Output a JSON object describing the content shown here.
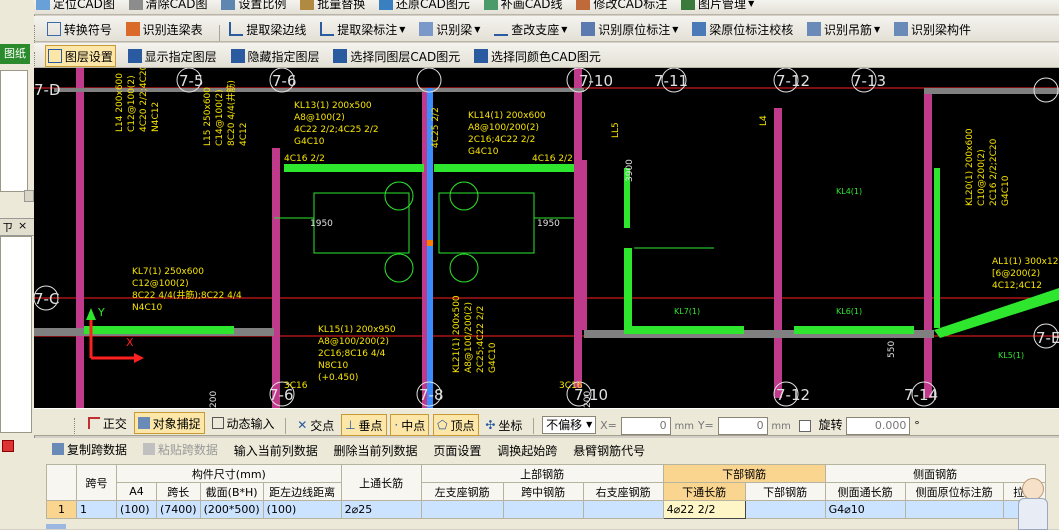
{
  "toolbar1": {
    "items": [
      "定位CAD图",
      "清除CAD图",
      "设置比例",
      "批量替换",
      "还原CAD图元",
      "补画CAD线",
      "修改CAD标注",
      "图片管理"
    ]
  },
  "toolbar2": {
    "items": [
      "转换符号",
      "识别连梁表",
      "提取梁边线",
      "提取梁标注",
      "识别梁",
      "查改支座",
      "识别原位标注",
      "梁原位标注校核",
      "识别吊筋",
      "识别梁构件"
    ]
  },
  "toolbar3": {
    "items": [
      "图层设置",
      "显示指定图层",
      "隐藏指定图层",
      "选择同图层CAD图元",
      "选择同颜色CAD图元"
    ]
  },
  "left_panel": {
    "tab_label": "图纸",
    "pin": "ㄗ",
    "close": "×"
  },
  "cad": {
    "axes": [
      "7-5",
      "7-6",
      "7-7",
      "7-8",
      "7-9",
      "7-10",
      "7-11",
      "7-12",
      "7-13",
      "7-14"
    ],
    "row_axes": [
      "7-D",
      "7-C",
      "7-E"
    ],
    "beam_labels": {
      "kl13": [
        "KL13(1) 200x500",
        "A8@100(2)",
        "4C22 2/2;4C25 2/2",
        "G4C10"
      ],
      "kl14": [
        "KL14(1) 200x600",
        "A8@100/200(2)",
        "2C16;4C22 2/2",
        "G4C10"
      ],
      "kl7": [
        "KL7(1) 250x600",
        "C12@100(2)",
        "8C22 4/4(井筋);8C22 4/4",
        "N4C10"
      ],
      "kl15": [
        "KL15(1) 200x950",
        "A8@100/200(2)",
        "2C16;8C16 4/4",
        "N8C10",
        "(+0.450)"
      ],
      "kl20": [
        "KL20(1) 200x600",
        "C10@200(2)",
        "2C16 2/2;2C20",
        "G4C10"
      ],
      "al1": [
        "AL1(1) 300x120",
        "[6@200(2)",
        "4C12;4C12"
      ],
      "kl21": [
        "KL21(1) 200x500",
        "A8@100/200(2)",
        "2C25;4C22 2/2",
        "G4C10"
      ],
      "misc": [
        "4C16 2/2",
        "4C16 2/2",
        "1950",
        "1950",
        "3900",
        "KL4(1)",
        "KL7(1)",
        "KL6(1)",
        "KL5(1)",
        "550",
        "4C25 2/2",
        "L14 200x600",
        "C12@100(2)",
        "4C20 2/2;4C20",
        "N4C12",
        "L15 250x600",
        "C14@100(2)",
        "8C20 4/4(井筋)",
        "4C12",
        "LL5",
        "L4",
        "3C16",
        "3C16",
        "200",
        "200",
        "7-1"
      ]
    }
  },
  "snapbar": {
    "items": [
      "正交",
      "对象捕捉",
      "动态输入",
      "交点",
      "垂点",
      "中点",
      "顶点",
      "坐标"
    ],
    "mode": "不偏移",
    "x_label": "X=",
    "x_value": "0",
    "x_unit": "mm",
    "y_label": "Y=",
    "y_value": "0",
    "y_unit": "mm",
    "rotate_label": "旋转",
    "rotate_value": "0.000",
    "deg": "°"
  },
  "table_toolbar": {
    "items": [
      "复制跨数据",
      "粘贴跨数据",
      "输入当前列数据",
      "删除当前列数据",
      "页面设置",
      "调换起始跨",
      "悬臂钢筋代号"
    ]
  },
  "grid": {
    "headers_top": [
      "跨号",
      "构件尺寸(mm)",
      "上通长筋",
      "上部钢筋",
      "下部钢筋",
      "侧面钢筋"
    ],
    "headers_sub": [
      "A4",
      "跨长",
      "截面(B*H)",
      "距左边线距离",
      "左支座钢筋",
      "跨中钢筋",
      "右支座钢筋",
      "下通长筋",
      "下部钢筋",
      "侧面通长筋",
      "侧面原位标注筋",
      "拉筋"
    ],
    "rows": [
      {
        "row_no": "1",
        "span": "1",
        "a4": "(100)",
        "span_len": "(7400)",
        "section": "(200*500)",
        "dist": "(100)",
        "top_long": "2⌀25",
        "left_sup": "",
        "mid": "",
        "right_sup": "",
        "bottom_long": "4⌀22 2/2",
        "bottom": "",
        "side_long": "G4⌀10",
        "side_orig": "",
        "tie": ""
      }
    ]
  },
  "colors": {
    "beam": "#2ee62e",
    "column": "#c03a8c",
    "axis_red": "#ff2020",
    "label_yellow": "#f7e400",
    "canvas": "#000000"
  }
}
